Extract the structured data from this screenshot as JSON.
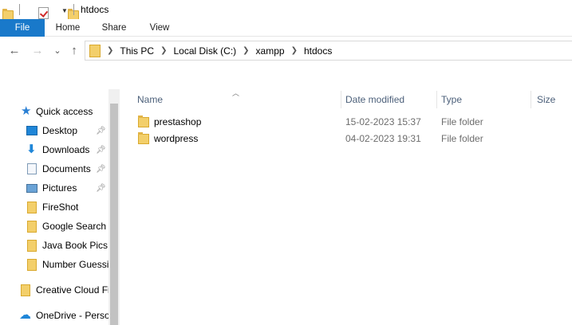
{
  "window": {
    "title": "htdocs"
  },
  "ribbon": {
    "tabs": [
      {
        "label": "File"
      },
      {
        "label": "Home"
      },
      {
        "label": "Share"
      },
      {
        "label": "View"
      }
    ]
  },
  "nav": {
    "back_icon": "←",
    "forward_icon": "→",
    "recent_icon": "⌄",
    "up_icon": "↑"
  },
  "address": {
    "crumbs": [
      "This PC",
      "Local Disk (C:)",
      "xampp",
      "htdocs"
    ]
  },
  "sidebar": {
    "items": [
      {
        "label": "Quick access",
        "icon": "star-icon"
      },
      {
        "label": "Desktop",
        "icon": "desktop-icon",
        "pinned": true
      },
      {
        "label": "Downloads",
        "icon": "download-icon",
        "pinned": true
      },
      {
        "label": "Documents",
        "icon": "documents-icon",
        "pinned": true
      },
      {
        "label": "Pictures",
        "icon": "pictures-icon",
        "pinned": true
      },
      {
        "label": "FireShot",
        "icon": "folder-icon"
      },
      {
        "label": "Google Search c",
        "icon": "folder-icon"
      },
      {
        "label": "Java Book Pics (",
        "icon": "folder-icon"
      },
      {
        "label": "Number Guessi",
        "icon": "folder-icon"
      },
      {
        "label": "Creative Cloud Fi",
        "icon": "creative-cloud-icon"
      },
      {
        "label": "OneDrive - Perso",
        "icon": "onedrive-icon"
      }
    ]
  },
  "list": {
    "columns": [
      "Name",
      "Date modified",
      "Type",
      "Size"
    ],
    "rows": [
      {
        "name": "prestashop",
        "date": "15-02-2023 15:37",
        "type": "File folder"
      },
      {
        "name": "wordpress",
        "date": "04-02-2023 19:31",
        "type": "File folder"
      }
    ]
  }
}
